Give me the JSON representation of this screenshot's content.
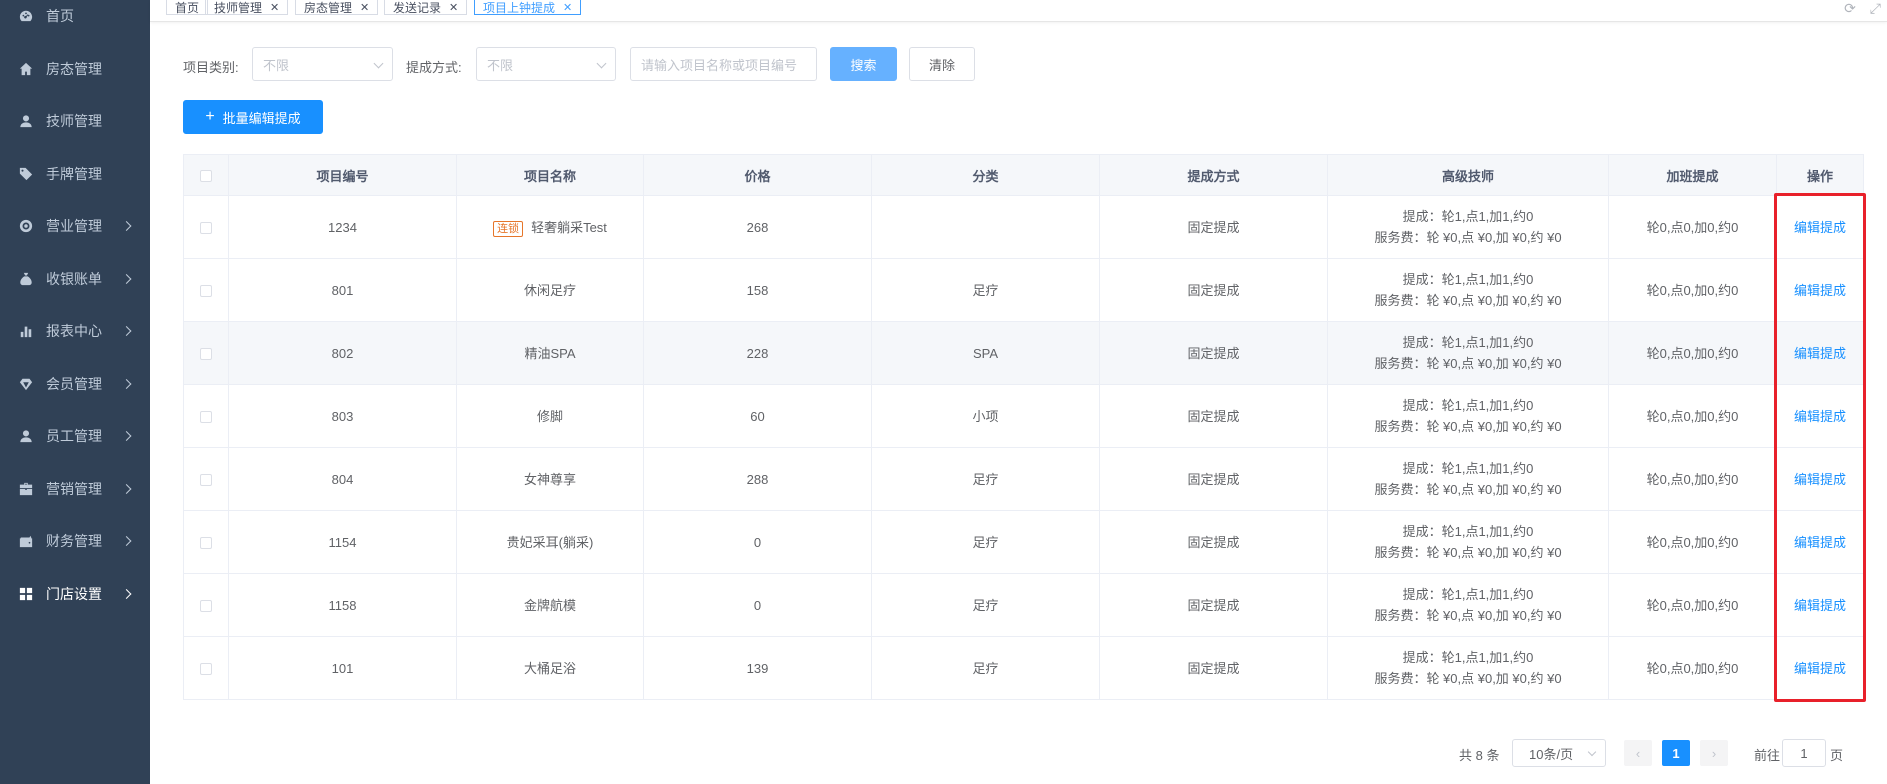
{
  "sidebar": {
    "items": [
      {
        "label": "首页",
        "icon": "dashboard-icon",
        "arrow": false
      },
      {
        "label": "房态管理",
        "icon": "home-icon",
        "arrow": false
      },
      {
        "label": "技师管理",
        "icon": "user-icon",
        "arrow": false
      },
      {
        "label": "手牌管理",
        "icon": "tag-icon",
        "arrow": false
      },
      {
        "label": "营业管理",
        "icon": "target-icon",
        "arrow": true
      },
      {
        "label": "收银账单",
        "icon": "money-bag-icon",
        "arrow": true
      },
      {
        "label": "报表中心",
        "icon": "bar-chart-icon",
        "arrow": true
      },
      {
        "label": "会员管理",
        "icon": "diamond-icon",
        "arrow": true
      },
      {
        "label": "员工管理",
        "icon": "user-icon",
        "arrow": true
      },
      {
        "label": "营销管理",
        "icon": "briefcase-icon",
        "arrow": true
      },
      {
        "label": "财务管理",
        "icon": "wallet-icon",
        "arrow": true
      },
      {
        "label": "门店设置",
        "icon": "grid-icon",
        "arrow": true,
        "active": true
      }
    ]
  },
  "tabs": [
    {
      "label": "首页",
      "closable": false
    },
    {
      "label": "技师管理",
      "closable": true
    },
    {
      "label": "房态管理",
      "closable": true
    },
    {
      "label": "发送记录",
      "closable": true
    },
    {
      "label": "项目上钟提成",
      "closable": true,
      "active": true
    }
  ],
  "filter": {
    "category_label": "项目类别:",
    "category_value": "不限",
    "method_label": "提成方式:",
    "method_value": "不限",
    "search_placeholder": "请输入项目名称或项目编号",
    "search_button": "搜索",
    "clear_button": "清除"
  },
  "batch_button": "批量编辑提成",
  "table": {
    "columns": [
      "项目编号",
      "项目名称",
      "价格",
      "分类",
      "提成方式",
      "高级技师",
      "加班提成",
      "操作"
    ],
    "rows": [
      {
        "code": "1234",
        "tag": "连锁",
        "name": "轻奢躺采Test",
        "price": "268",
        "category": "",
        "method": "固定提成",
        "commission": "提成：轮1,点1,加1,约0",
        "fee": "服务费：轮 ¥0,点 ¥0,加 ¥0,约 ¥0",
        "overtime": "轮0,点0,加0,约0",
        "action": "编辑提成"
      },
      {
        "code": "801",
        "name": "休闲足疗",
        "price": "158",
        "category": "足疗",
        "method": "固定提成",
        "commission": "提成：轮1,点1,加1,约0",
        "fee": "服务费：轮 ¥0,点 ¥0,加 ¥0,约 ¥0",
        "overtime": "轮0,点0,加0,约0",
        "action": "编辑提成"
      },
      {
        "code": "802",
        "name": "精油SPA",
        "price": "228",
        "category": "SPA",
        "method": "固定提成",
        "commission": "提成：轮1,点1,加1,约0",
        "fee": "服务费：轮 ¥0,点 ¥0,加 ¥0,约 ¥0",
        "overtime": "轮0,点0,加0,约0",
        "action": "编辑提成"
      },
      {
        "code": "803",
        "name": "修脚",
        "price": "60",
        "category": "小项",
        "method": "固定提成",
        "commission": "提成：轮1,点1,加1,约0",
        "fee": "服务费：轮 ¥0,点 ¥0,加 ¥0,约 ¥0",
        "overtime": "轮0,点0,加0,约0",
        "action": "编辑提成"
      },
      {
        "code": "804",
        "name": "女神尊享",
        "price": "288",
        "category": "足疗",
        "method": "固定提成",
        "commission": "提成：轮1,点1,加1,约0",
        "fee": "服务费：轮 ¥0,点 ¥0,加 ¥0,约 ¥0",
        "overtime": "轮0,点0,加0,约0",
        "action": "编辑提成"
      },
      {
        "code": "1154",
        "name": "贵妃采耳(躺采)",
        "price": "0",
        "category": "足疗",
        "method": "固定提成",
        "commission": "提成：轮1,点1,加1,约0",
        "fee": "服务费：轮 ¥0,点 ¥0,加 ¥0,约 ¥0",
        "overtime": "轮0,点0,加0,约0",
        "action": "编辑提成"
      },
      {
        "code": "1158",
        "name": "金牌航模",
        "price": "0",
        "category": "足疗",
        "method": "固定提成",
        "commission": "提成：轮1,点1,加1,约0",
        "fee": "服务费：轮 ¥0,点 ¥0,加 ¥0,约 ¥0",
        "overtime": "轮0,点0,加0,约0",
        "action": "编辑提成"
      },
      {
        "code": "101",
        "name": "大桶足浴",
        "price": "139",
        "category": "足疗",
        "method": "固定提成",
        "commission": "提成：轮1,点1,加1,约0",
        "fee": "服务费：轮 ¥0,点 ¥0,加 ¥0,约 ¥0",
        "overtime": "轮0,点0,加0,约0",
        "action": "编辑提成"
      }
    ]
  },
  "pagination": {
    "total": "共 8 条",
    "page_size": "10条/页",
    "current_page": "1",
    "goto_label": "前往",
    "goto_value": "1",
    "page_suffix": "页"
  },
  "colors": {
    "sidebar_bg": "#304156",
    "primary": "#1890ff",
    "highlight_box": "#e8202a"
  }
}
